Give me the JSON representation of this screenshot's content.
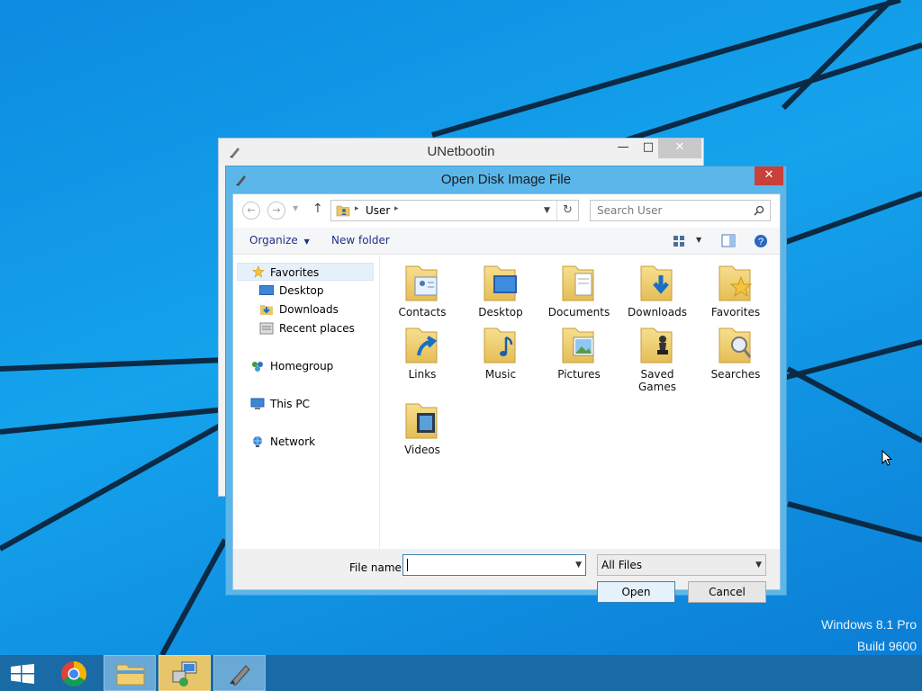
{
  "desktop": {
    "os_name": "Windows 8.1 Pro",
    "build": "Build 9600"
  },
  "unetbootin": {
    "title": "UNetbootin",
    "min_glyph": "—",
    "max_glyph": "□",
    "close_glyph": "✕"
  },
  "dialog": {
    "title": "Open Disk Image File",
    "close_glyph": "✕",
    "address": {
      "breadcrumb": "User",
      "separator": "▸"
    },
    "search": {
      "placeholder": "Search User"
    },
    "toolbar": {
      "organize_label": "Organize",
      "new_folder_label": "New folder"
    },
    "nav": {
      "favorites": "Favorites",
      "desktop": "Desktop",
      "downloads": "Downloads",
      "recent_places": "Recent places",
      "homegroup": "Homegroup",
      "this_pc": "This PC",
      "network": "Network"
    },
    "files": [
      {
        "label": "Contacts",
        "icon": "contacts-folder-icon"
      },
      {
        "label": "Desktop",
        "icon": "desktop-folder-icon"
      },
      {
        "label": "Documents",
        "icon": "documents-folder-icon"
      },
      {
        "label": "Downloads",
        "icon": "downloads-folder-icon"
      },
      {
        "label": "Favorites",
        "icon": "favorites-folder-icon"
      },
      {
        "label": "Links",
        "icon": "links-folder-icon"
      },
      {
        "label": "Music",
        "icon": "music-folder-icon"
      },
      {
        "label": "Pictures",
        "icon": "pictures-folder-icon"
      },
      {
        "label": "Saved Games",
        "icon": "saved-games-folder-icon"
      },
      {
        "label": "Searches",
        "icon": "searches-folder-icon"
      },
      {
        "label": "Videos",
        "icon": "videos-folder-icon"
      }
    ],
    "footer": {
      "file_name_label": "File name:",
      "file_name_value": "",
      "file_type_value": "All Files",
      "open_label": "Open",
      "cancel_label": "Cancel"
    }
  },
  "colors": {
    "accent": "#5bb6ea",
    "close_red": "#c7403a",
    "taskbar": "#1a6aa6",
    "desktop_blue": "#0d8ee0"
  }
}
